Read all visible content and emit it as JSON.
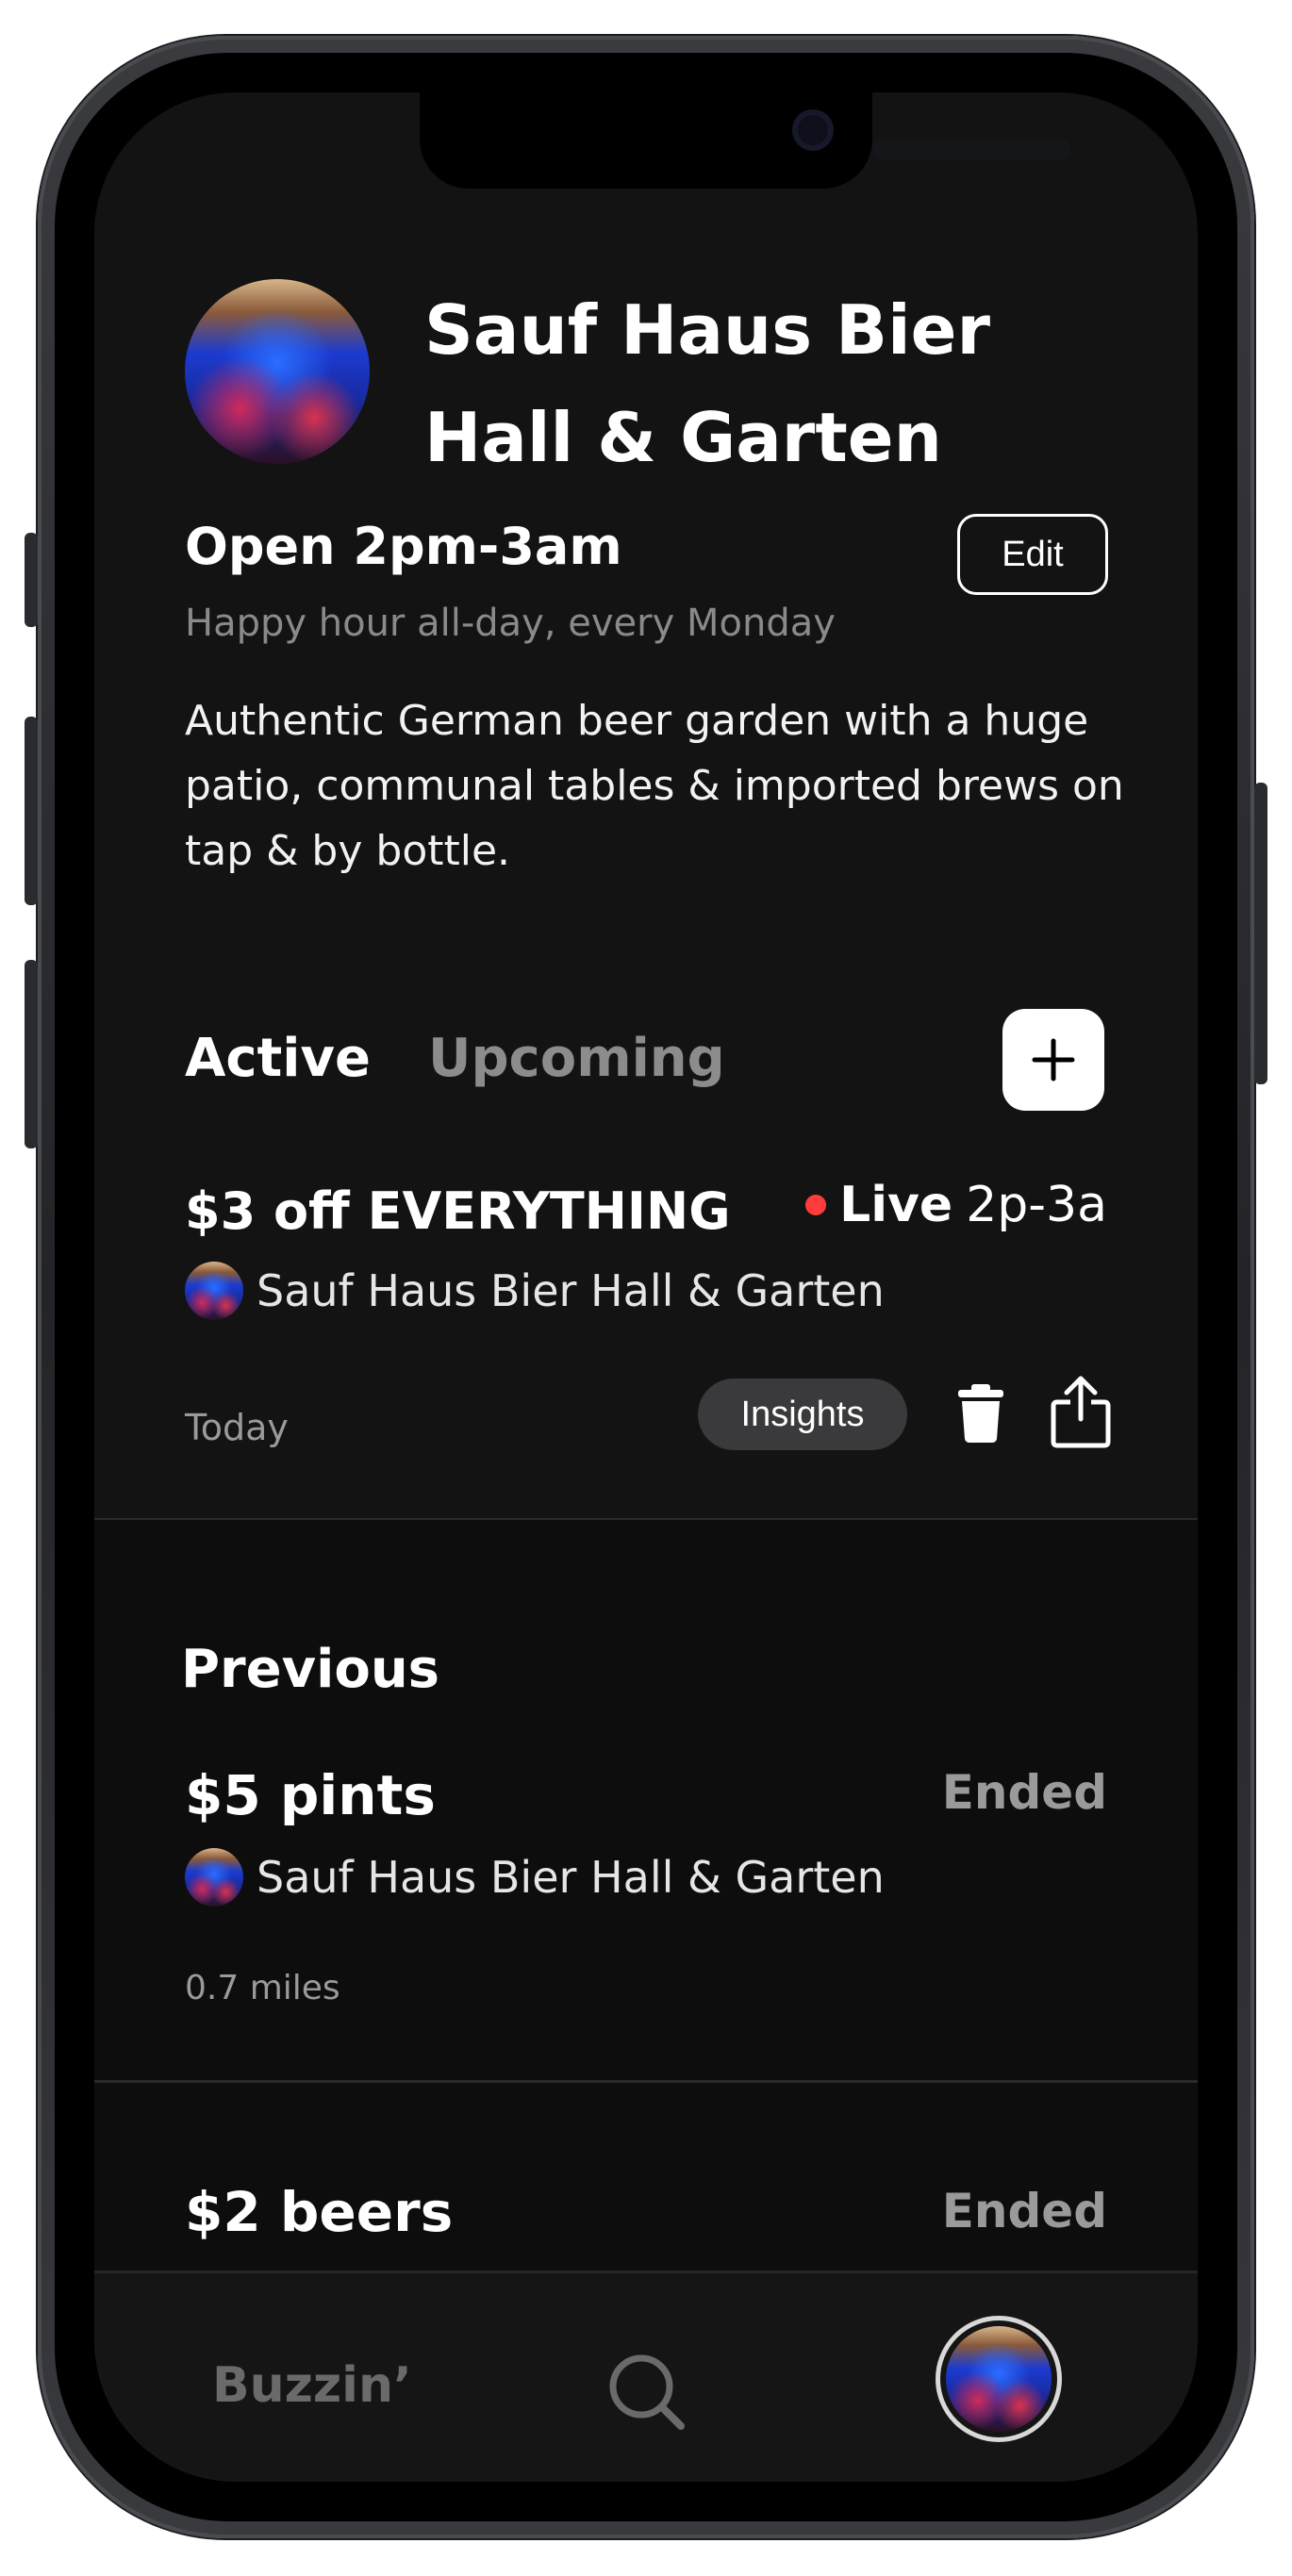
{
  "venue": {
    "name": "Sauf Haus Bier Hall & Garten",
    "hours": "Open 2pm-3am",
    "happy_hour": "Happy hour all-day, every Monday",
    "description": "Authentic German beer garden with a huge patio, communal tables & imported brews on tap & by bottle.",
    "edit_label": "Edit"
  },
  "tabs": {
    "active_label": "Active",
    "upcoming_label": "Upcoming"
  },
  "active_deal": {
    "title": "$3 off EVERYTHING",
    "status_label": "Live",
    "time_range": "2p-3a",
    "venue_name": "Sauf Haus Bier Hall & Garten",
    "date_label": "Today",
    "insights_label": "Insights"
  },
  "previous": {
    "heading": "Previous",
    "items": [
      {
        "title": "$5 pints",
        "status": "Ended",
        "venue_name": "Sauf Haus Bier Hall & Garten",
        "distance": "0.7 miles"
      },
      {
        "title": "$2 beers",
        "status": "Ended"
      }
    ]
  },
  "nav": {
    "home_label": "Buzzin’"
  },
  "icons": {
    "add": "plus-icon",
    "delete": "trash-icon",
    "share": "share-icon",
    "search": "search-icon",
    "profile": "avatar"
  },
  "colors": {
    "background": "#131313",
    "live_dot": "#ff3b3b",
    "muted_text": "#8a8a8a",
    "chip": "#3a3a3c"
  }
}
